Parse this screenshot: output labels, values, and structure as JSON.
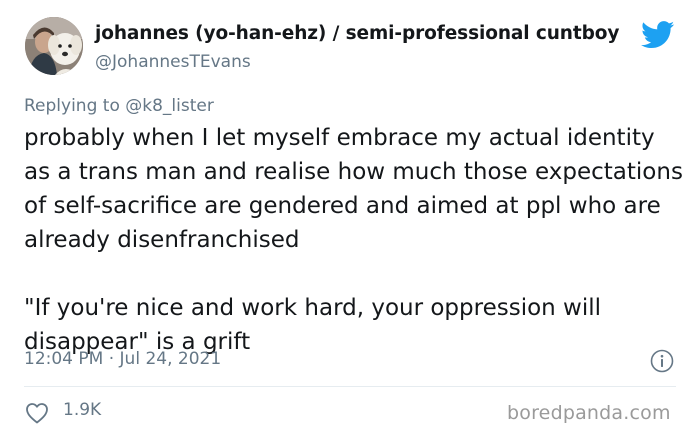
{
  "author": {
    "display_name": "johannes (yo-han-ehz) / semi-professional cuntboy",
    "handle": "@JohannesTEvans",
    "avatar_icon": "profile-photo-with-dog"
  },
  "platform_icon": "twitter-bird-icon",
  "reply": {
    "prefix": "Replying to ",
    "mention": "@k8_lister"
  },
  "tweet": {
    "text": "probably when I let myself embrace my actual identity as a trans man and realise how much those expectations of self-sacrifice are gendered and aimed at ppl who are already disenfranchised\n\n\"If you're nice and work hard, your oppression will disappear\" is a grift",
    "timestamp": "12:04 PM · Jul 24, 2021",
    "likes": "1.9K"
  },
  "watermark": "boredpanda.com",
  "colors": {
    "text": "#14171a",
    "secondary": "#657786",
    "twitter_blue": "#1da1f2",
    "divider": "#e6ecf0",
    "watermark": "#9a9a9a"
  }
}
